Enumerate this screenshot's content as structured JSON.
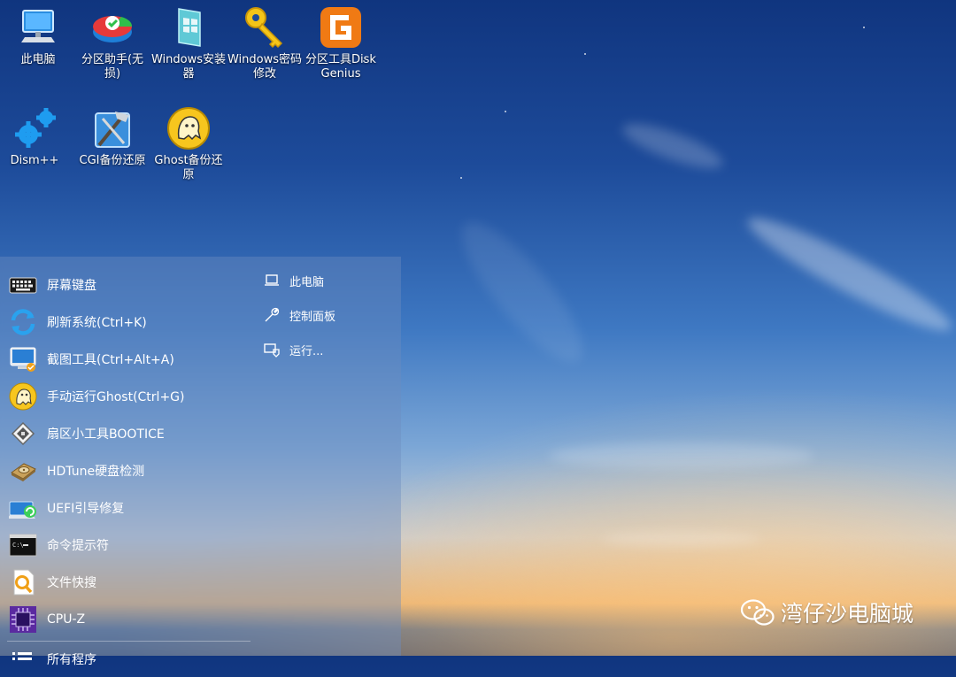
{
  "desktop": {
    "icons": [
      {
        "label": "此电脑",
        "icon": "computer-icon"
      },
      {
        "label": "分区助手(无损)",
        "icon": "partition-assistant-icon"
      },
      {
        "label": "Windows安装器",
        "icon": "windows-installer-icon"
      },
      {
        "label": "Windows密码修改",
        "icon": "key-icon"
      },
      {
        "label": "分区工具DiskGenius",
        "icon": "diskgenius-icon"
      },
      {
        "label": "Dism++",
        "icon": "gears-icon"
      },
      {
        "label": "CGI备份还原",
        "icon": "cgi-tools-icon"
      },
      {
        "label": "Ghost备份还原",
        "icon": "ghost-icon"
      }
    ]
  },
  "start_menu": {
    "left_items": [
      {
        "label": "屏幕键盘",
        "icon": "keyboard-icon"
      },
      {
        "label": "刷新系统(Ctrl+K)",
        "icon": "refresh-icon"
      },
      {
        "label": "截图工具(Ctrl+Alt+A)",
        "icon": "screenshot-icon"
      },
      {
        "label": "手动运行Ghost(Ctrl+G)",
        "icon": "ghost-icon"
      },
      {
        "label": "扇区小工具BOOTICE",
        "icon": "bootice-icon"
      },
      {
        "label": "HDTune硬盘检测",
        "icon": "harddisk-icon"
      },
      {
        "label": "UEFI引导修复",
        "icon": "uefi-repair-icon"
      },
      {
        "label": "命令提示符",
        "icon": "cmd-icon"
      },
      {
        "label": "文件快搜",
        "icon": "file-search-icon"
      },
      {
        "label": "CPU-Z",
        "icon": "cpu-icon"
      },
      {
        "label": "所有程序",
        "icon": "list-icon"
      }
    ],
    "right_items": [
      {
        "label": "此电脑",
        "icon": "laptop-icon"
      },
      {
        "label": "控制面板",
        "icon": "wrench-icon"
      },
      {
        "label": "运行...",
        "icon": "run-icon"
      }
    ]
  },
  "watermark": {
    "text": "湾仔沙电脑城",
    "icon": "wechat-icon"
  },
  "colors": {
    "menu_bg": "#6e8cbe",
    "ghost_yellow": "#f7c61e",
    "diskgenius_orange": "#f07a14"
  }
}
